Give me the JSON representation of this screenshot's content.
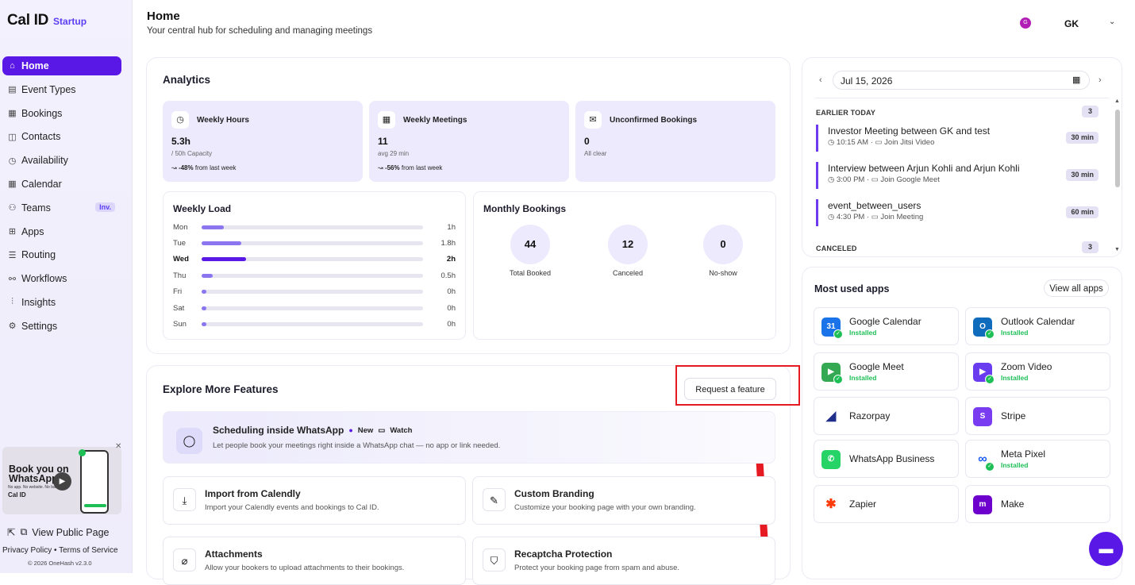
{
  "brand": {
    "name": "Cal ID",
    "plan": "Startup"
  },
  "sidebar": {
    "items": [
      {
        "label": "Home",
        "icon": "home-icon",
        "glyph": "⌂"
      },
      {
        "label": "Event Types",
        "icon": "event-types-icon",
        "glyph": "▤"
      },
      {
        "label": "Bookings",
        "icon": "calendar-icon",
        "glyph": "▦"
      },
      {
        "label": "Contacts",
        "icon": "contacts-icon",
        "glyph": "◫"
      },
      {
        "label": "Availability",
        "icon": "clock-icon",
        "glyph": "◷"
      },
      {
        "label": "Calendar",
        "icon": "calendar-icon",
        "glyph": "▦"
      },
      {
        "label": "Teams",
        "icon": "users-icon",
        "glyph": "⚇",
        "badge": "Inv."
      },
      {
        "label": "Apps",
        "icon": "grid-icon",
        "glyph": "⊞"
      },
      {
        "label": "Routing",
        "icon": "routing-icon",
        "glyph": "☰"
      },
      {
        "label": "Workflows",
        "icon": "workflow-icon",
        "glyph": "⚯"
      },
      {
        "label": "Insights",
        "icon": "chart-icon",
        "glyph": "⫶"
      },
      {
        "label": "Settings",
        "icon": "gear-icon",
        "glyph": "⚙"
      }
    ],
    "promo": {
      "title": "Book you on WhatsApp",
      "small": "No app. No website. No back",
      "brand": "Cal ID"
    },
    "public_page": "View Public Page",
    "footer_links": "Privacy Policy • Terms of Service",
    "footer_copy": "© 2026 OneHash v2.3.0"
  },
  "header": {
    "title": "Home",
    "subtitle": "Your central hub for scheduling and managing meetings",
    "user_initial": "G",
    "user_name": "GK"
  },
  "analytics": {
    "title": "Analytics",
    "stats": [
      {
        "title": "Weekly Hours",
        "value": "5.3h",
        "sub": "/ 50h Capacity",
        "trend_value": "-48%",
        "trend_text": " from last week",
        "icon": "clock-icon",
        "glyph": "◷"
      },
      {
        "title": "Weekly Meetings",
        "value": "11",
        "sub": "avg 29 min",
        "trend_value": "-56%",
        "trend_text": " from last week",
        "icon": "calendar-icon",
        "glyph": "▦"
      },
      {
        "title": "Unconfirmed Bookings",
        "value": "0",
        "sub": "All clear",
        "trend_value": "",
        "trend_text": "",
        "icon": "inbox-icon",
        "glyph": "✉"
      }
    ],
    "weekly_load": {
      "title": "Weekly Load",
      "rows": [
        {
          "day": "Mon",
          "value": "1h",
          "fraction": 0.1
        },
        {
          "day": "Tue",
          "value": "1.8h",
          "fraction": 0.18
        },
        {
          "day": "Wed",
          "value": "2h",
          "fraction": 0.2,
          "bold": true
        },
        {
          "day": "Thu",
          "value": "0.5h",
          "fraction": 0.05
        },
        {
          "day": "Fri",
          "value": "0h",
          "fraction": 0.02
        },
        {
          "day": "Sat",
          "value": "0h",
          "fraction": 0.02
        },
        {
          "day": "Sun",
          "value": "0h",
          "fraction": 0.02
        }
      ]
    },
    "monthly": {
      "title": "Monthly Bookings",
      "items": [
        {
          "value": "44",
          "label": "Total Booked"
        },
        {
          "value": "12",
          "label": "Canceled"
        },
        {
          "value": "0",
          "label": "No-show"
        }
      ]
    }
  },
  "explore": {
    "title": "Explore More Features",
    "request_label": "Request a feature",
    "highlight": {
      "title": "Scheduling inside WhatsApp",
      "new_tag": "New",
      "watch_tag": "Watch",
      "desc": "Let people book your meetings right inside a WhatsApp chat — no app or link needed."
    },
    "features": [
      {
        "title": "Import from Calendly",
        "desc": "Import your Calendly events and bookings to Cal ID.",
        "icon": "download-icon",
        "glyph": "⤓"
      },
      {
        "title": "Custom Branding",
        "desc": "Customize your booking page with your own branding.",
        "icon": "brush-icon",
        "glyph": "✎"
      },
      {
        "title": "Attachments",
        "desc": "Allow your bookers to upload attachments to their bookings.",
        "icon": "paperclip-icon",
        "glyph": "⌀"
      },
      {
        "title": "Recaptcha Protection",
        "desc": "Protect your booking page from spam and abuse.",
        "icon": "shield-icon",
        "glyph": "⛉"
      }
    ]
  },
  "schedule": {
    "date": "Jul 15, 2026",
    "groups": [
      {
        "label": "EARLIER TODAY",
        "count": "3"
      },
      {
        "label": "CANCELED",
        "count": "3"
      }
    ],
    "events": [
      {
        "title": "Investor Meeting between GK and test",
        "time": "10:15 AM",
        "join": "Join Jitsi Video",
        "duration": "30 min"
      },
      {
        "title": "Interview between Arjun Kohli and Arjun Kohli",
        "time": "3:00 PM",
        "join": "Join Google Meet",
        "duration": "30 min"
      },
      {
        "title": "event_between_users",
        "time": "4:30 PM",
        "join": "Join Meeting",
        "duration": "60 min"
      }
    ]
  },
  "apps": {
    "title": "Most used apps",
    "view_all": "View all apps",
    "items": [
      {
        "name": "Google Calendar",
        "installed": "Installed",
        "icon": "google-calendar-icon",
        "glyph": "31",
        "color": "#1a73e8"
      },
      {
        "name": "Outlook Calendar",
        "installed": "Installed",
        "icon": "outlook-calendar-icon",
        "glyph": "O",
        "color": "#0f6cbd"
      },
      {
        "name": "Google Meet",
        "installed": "Installed",
        "icon": "google-meet-icon",
        "glyph": "▶",
        "color": "#34a853"
      },
      {
        "name": "Zoom Video",
        "installed": "Installed",
        "icon": "zoom-icon",
        "glyph": "▶",
        "color": "#6a3cf0"
      },
      {
        "name": "Razorpay",
        "installed": "",
        "icon": "razorpay-icon",
        "glyph": "◢",
        "color": "#ffffff"
      },
      {
        "name": "Stripe",
        "installed": "",
        "icon": "stripe-icon",
        "glyph": "S",
        "color": "#7a3cf0"
      },
      {
        "name": "WhatsApp Business",
        "installed": "",
        "icon": "whatsapp-icon",
        "glyph": "✆",
        "color": "#25d366"
      },
      {
        "name": "Meta Pixel",
        "installed": "Installed",
        "icon": "meta-icon",
        "glyph": "∞",
        "color": "#ffffff"
      },
      {
        "name": "Zapier",
        "installed": "",
        "icon": "zapier-icon",
        "glyph": "✱",
        "color": "#ffffff"
      },
      {
        "name": "Make",
        "installed": "",
        "icon": "make-icon",
        "glyph": "m",
        "color": "#6d00cc"
      }
    ]
  }
}
